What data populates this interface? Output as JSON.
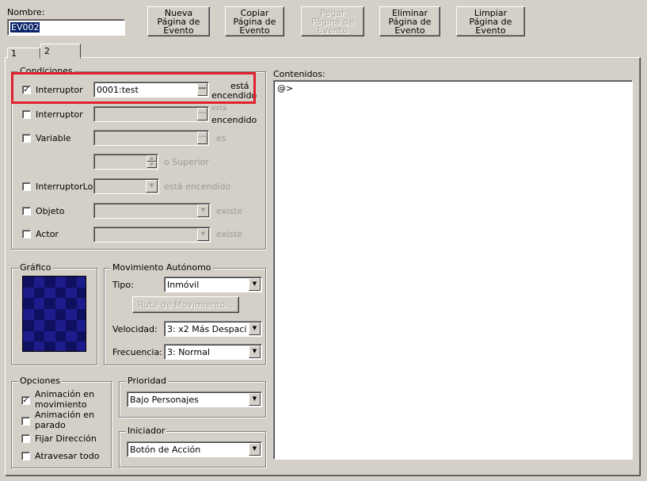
{
  "header": {
    "name_label": "Nombre:",
    "name_value": "EV002",
    "buttons": [
      {
        "line1": "Nueva",
        "line2": "Página de",
        "line3": "Evento",
        "enabled": true
      },
      {
        "line1": "Copiar",
        "line2": "Página de",
        "line3": "Evento",
        "enabled": true
      },
      {
        "line1": "Pegar",
        "line2": "Página de",
        "line3": "Evento",
        "enabled": false
      },
      {
        "line1": "Eliminar",
        "line2": "Página de",
        "line3": "Evento",
        "enabled": true
      },
      {
        "line1": "Limpiar",
        "line2": "Página de",
        "line3": "Evento",
        "enabled": true
      }
    ]
  },
  "tabs": [
    {
      "label": "1",
      "active": false
    },
    {
      "label": "2",
      "active": true
    }
  ],
  "conditions": {
    "legend": "Condiciones",
    "switch1": {
      "label": "Interruptor",
      "checked": true,
      "value": "0001:test",
      "suffix_line1": "está",
      "suffix_line2": "encendido"
    },
    "switch2": {
      "label": "Interruptor",
      "checked": false,
      "value": "",
      "suffix_line1": "está",
      "suffix_line2": "encendido"
    },
    "variable": {
      "label": "Variable",
      "checked": false,
      "value": "",
      "suffix": "es",
      "operand": "",
      "operand_suffix": "o Superior"
    },
    "local_switch": {
      "label": "InterruptorLo",
      "checked": false,
      "value": "",
      "suffix": "está encendido"
    },
    "item": {
      "label": "Objeto",
      "checked": false,
      "value": "",
      "suffix": "existe"
    },
    "actor": {
      "label": "Actor",
      "checked": false,
      "value": "",
      "suffix": "existe"
    }
  },
  "graphic": {
    "legend": "Gráfico",
    "tile_colors": [
      "#101060",
      "#1c1c8c"
    ]
  },
  "autonomous": {
    "legend": "Movimiento Autónomo",
    "type_label": "Tipo:",
    "type_value": "Inmóvil",
    "route_button": "Ruta de Movimiento...",
    "speed_label": "Velocidad:",
    "speed_value": "3: x2 Más Despaci",
    "freq_label": "Frecuencia:",
    "freq_value": "3: Normal"
  },
  "options": {
    "legend": "Opciones",
    "items": [
      {
        "line1": "Animación en",
        "line2": "movimiento",
        "checked": true
      },
      {
        "line1": "Animación en",
        "line2": "parado",
        "checked": false
      },
      {
        "line1": "Fijar Dirección",
        "line2": "",
        "checked": false
      },
      {
        "line1": "Atravesar todo",
        "line2": "",
        "checked": false
      }
    ]
  },
  "priority": {
    "legend": "Prioridad",
    "value": "Bajo Personajes"
  },
  "trigger": {
    "legend": "Iniciador",
    "value": "Botón de Acción"
  },
  "contents": {
    "label": "Contenidos:",
    "lines": [
      "@>"
    ]
  },
  "colors": {
    "highlight": "#e0202a",
    "selection": "#0a246a"
  }
}
